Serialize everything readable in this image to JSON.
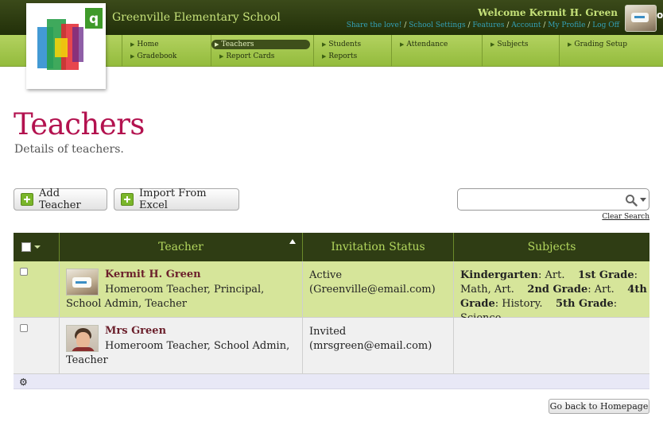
{
  "header": {
    "school_name": "Greenville Elementary School",
    "welcome": "Welcome Kermit H. Green",
    "links": [
      "Share the love!",
      "School Settings",
      "Features",
      "Account",
      "My Profile",
      "Log Off"
    ],
    "logo_letter": "q",
    "edge_letter": "o"
  },
  "nav": [
    {
      "label": "Home",
      "active": false
    },
    {
      "label": "Gradebook",
      "active": false
    },
    {
      "label": "Teachers",
      "active": true
    },
    {
      "label": "Report Cards",
      "active": false
    },
    {
      "label": "Students",
      "active": false
    },
    {
      "label": "Reports",
      "active": false
    },
    {
      "label": "Attendance",
      "active": false
    },
    {
      "label": "Subjects",
      "active": false
    },
    {
      "label": "Grading Setup",
      "active": false
    }
  ],
  "page": {
    "title": "Teachers",
    "subtitle": "Details of teachers."
  },
  "actions": {
    "add_teacher": "Add Teacher",
    "import_excel": "Import From Excel"
  },
  "search": {
    "value": "",
    "clear_label": "Clear Search"
  },
  "table": {
    "columns": {
      "teacher": "Teacher",
      "invitation_status": "Invitation Status",
      "subjects": "Subjects"
    },
    "rows": [
      {
        "name": "Kermit H. Green",
        "roles": "Homeroom Teacher, Principal, School Admin, Teacher",
        "status": "Active",
        "email": "(Greenville@email.com)",
        "subjects": [
          {
            "grade": "Kindergarten",
            "subjects": "Art."
          },
          {
            "grade": "1st Grade",
            "subjects": "Math, Art."
          },
          {
            "grade": "2nd Grade",
            "subjects": "Art."
          },
          {
            "grade": "4th Grade",
            "subjects": "History."
          },
          {
            "grade": "5th Grade",
            "subjects": "Science."
          }
        ]
      },
      {
        "name": "Mrs Green",
        "roles": "Homeroom Teacher, School Admin, Teacher",
        "status": "Invited",
        "email": "(mrsgreen@email.com)",
        "subjects": []
      }
    ]
  },
  "footer": {
    "back_label": "Go back to Homepage"
  },
  "colors": {
    "title": "#b3124f",
    "nav_bg": "#a5c84e",
    "topbar_bg": "#2b3a10",
    "table_head": "#2f3d14",
    "row_highlight": "#d6e59a",
    "link": "#34a0b5"
  }
}
